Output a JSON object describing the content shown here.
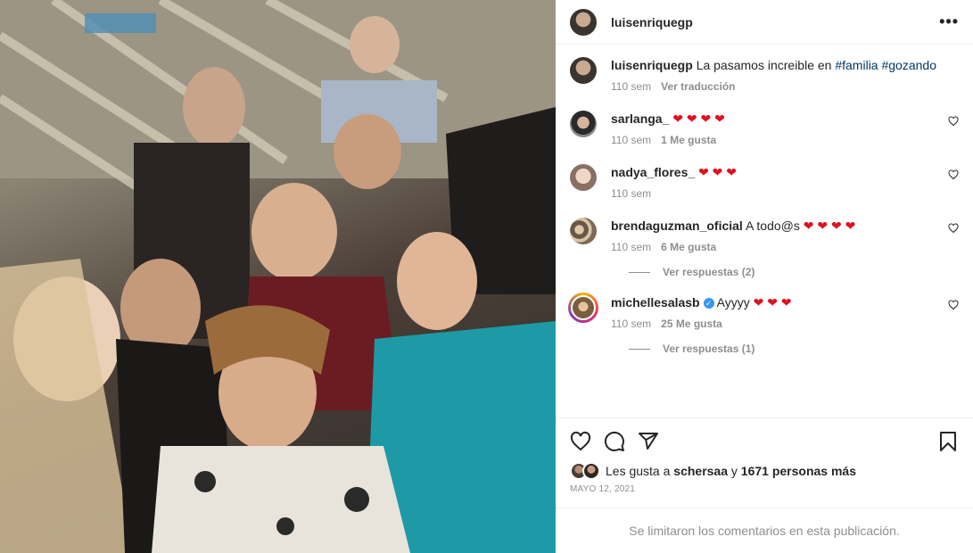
{
  "post": {
    "author": "luisenriquegp",
    "more_label": "•••",
    "caption": {
      "user": "luisenriquegp",
      "text_before": "La pasamos increible en ",
      "tag1": "#familia",
      "space": " ",
      "tag2": "#gozando",
      "time": "110 sem",
      "translate": "Ver traducción"
    }
  },
  "comments": [
    {
      "user": "sarlanga_",
      "text": "",
      "emoji": "❤ ❤ ❤ ❤",
      "time": "110 sem",
      "likes": "1 Me gusta"
    },
    {
      "user": "nadya_flores_",
      "text": "",
      "emoji": "❤ ❤ ❤",
      "time": "110 sem",
      "likes": ""
    },
    {
      "user": "brendaguzman_oficial",
      "text": "A todo@s",
      "emoji": "❤ ❤ ❤ ❤",
      "time": "110 sem",
      "likes": "6 Me gusta",
      "replies": "Ver respuestas (2)"
    },
    {
      "user": "michellesalasb",
      "text": "Ayyyy",
      "emoji": "❤ ❤ ❤",
      "time": "110 sem",
      "likes": "25 Me gusta",
      "replies": "Ver respuestas (1)",
      "verified_mark": "✓"
    }
  ],
  "likes": {
    "prefix": "Les gusta a",
    "user": "schersaa",
    "conj": "y",
    "others": "1671 personas más"
  },
  "date": "MAYO 12, 2021",
  "limited_notice": "Se limitaron los comentarios en esta publicación.",
  "icons": [
    "heart-icon",
    "comment-icon",
    "share-icon",
    "bookmark-icon",
    "more-icon"
  ],
  "colors": {
    "hashtag": "#00376b",
    "heart": "#e0101f",
    "verified": "#3897f0",
    "muted": "#8e8e8e"
  }
}
